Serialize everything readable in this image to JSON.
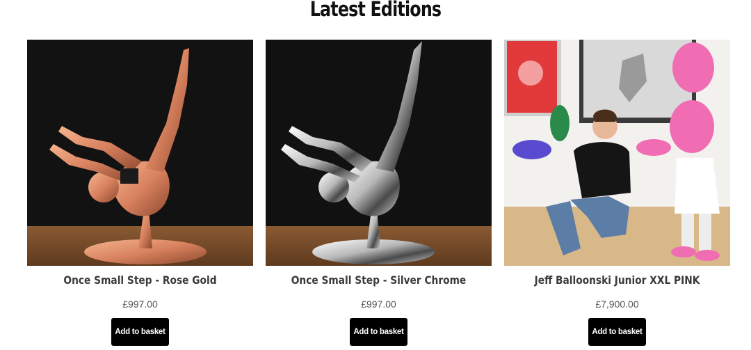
{
  "section": {
    "title": "Latest Editions"
  },
  "products": [
    {
      "name": "Once Small Step - Rose Gold",
      "price": "£997.00",
      "button_label": "Add to basket",
      "image_desc": "astronaut-sculpture-rose-gold"
    },
    {
      "name": "Once Small Step - Silver Chrome",
      "price": "£997.00",
      "button_label": "Add to basket",
      "image_desc": "astronaut-sculpture-silver-chrome"
    },
    {
      "name": "Jeff Balloonski Junior XXL PINK",
      "price": "£7,900.00",
      "button_label": "Add to basket",
      "image_desc": "pink-balloon-sculpture-with-man"
    }
  ],
  "colors": {
    "button_bg": "#000000",
    "button_text": "#ffffff",
    "rose_gold": "#d9825f",
    "silver": "#c9c9c9",
    "pink": "#f06db4"
  }
}
